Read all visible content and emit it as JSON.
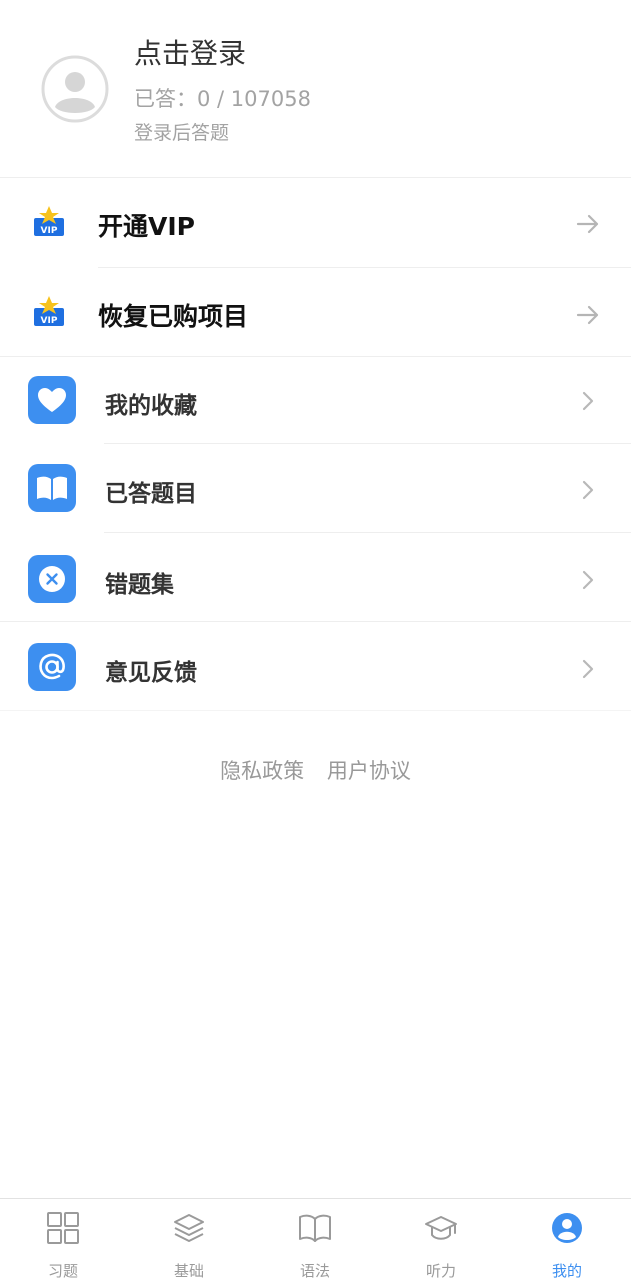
{
  "profile": {
    "title": "点击登录",
    "answered": "已答：0 / 107058",
    "hint": "登录后答题"
  },
  "vip_items": [
    {
      "label": "开通VIP",
      "icon": "vip-icon"
    },
    {
      "label": "恢复已购项目",
      "icon": "vip-icon"
    }
  ],
  "menu": [
    {
      "label": "我的收藏",
      "icon": "heart-icon"
    },
    {
      "label": "已答题目",
      "icon": "book-icon"
    },
    {
      "label": "错题集",
      "icon": "close-circle-icon"
    },
    {
      "label": "意见反馈",
      "icon": "at-icon"
    }
  ],
  "links": {
    "privacy": "隐私政策",
    "agreement": "用户协议"
  },
  "tabs": [
    {
      "label": "习题",
      "icon": "grid-icon"
    },
    {
      "label": "基础",
      "icon": "layers-icon"
    },
    {
      "label": "语法",
      "icon": "book-open-icon"
    },
    {
      "label": "听力",
      "icon": "graduation-cap-icon"
    },
    {
      "label": "我的",
      "icon": "user-circle-icon"
    }
  ],
  "colors": {
    "accent": "#3d8ff0",
    "tab_inactive": "#9a9a9a"
  }
}
